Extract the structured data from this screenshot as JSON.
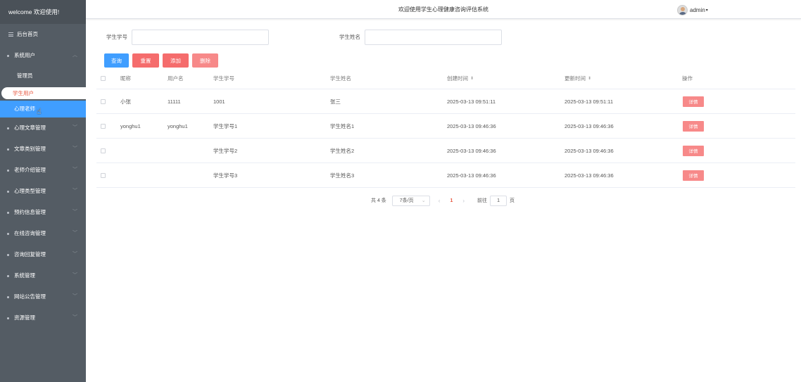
{
  "sidebar": {
    "welcome": "welcome 欢迎使用!",
    "home": "后台首页",
    "system_users": "系统用户",
    "sub_items": [
      "管理员",
      "学生用户",
      "心理老师"
    ],
    "menus": [
      "心理文章管理",
      "文章类别管理",
      "老师介绍管理",
      "心理类型管理",
      "预约信息管理",
      "在线咨询管理",
      "咨询回复管理",
      "系统管理",
      "网站公告管理",
      "资源管理"
    ]
  },
  "header": {
    "title": "欢迎使用学生心理健康咨询评估系统",
    "username": "admin"
  },
  "search": {
    "student_id_label": "学生学号",
    "student_id_value": "",
    "student_name_label": "学生姓名",
    "student_name_value": ""
  },
  "buttons": {
    "query": "查询",
    "reset": "重置",
    "add": "添加",
    "delete": "删除"
  },
  "table": {
    "columns": [
      "昵称",
      "用户名",
      "学生学号",
      "学生姓名",
      "创建时间",
      "更新时间",
      "操作"
    ],
    "rows": [
      {
        "nickname": "小张",
        "username": "11111",
        "student_id": "1001",
        "student_name": "张三",
        "created": "2025-03-13 09:51:11",
        "updated": "2025-03-13 09:51:11",
        "action": "详情"
      },
      {
        "nickname": "yonghu1",
        "username": "yonghu1",
        "student_id": "学生学号1",
        "student_name": "学生姓名1",
        "created": "2025-03-13 09:46:36",
        "updated": "2025-03-13 09:46:36",
        "action": "详情"
      },
      {
        "nickname": "",
        "username": "",
        "student_id": "学生学号2",
        "student_name": "学生姓名2",
        "created": "2025-03-13 09:46:36",
        "updated": "2025-03-13 09:46:36",
        "action": "详情"
      },
      {
        "nickname": "",
        "username": "",
        "student_id": "学生学号3",
        "student_name": "学生姓名3",
        "created": "2025-03-13 09:46:36",
        "updated": "2025-03-13 09:46:36",
        "action": "详情"
      }
    ]
  },
  "pagination": {
    "total": "共 4 条",
    "page_size": "7条/页",
    "current_page": "1",
    "goto_label": "前往",
    "goto_value": "1",
    "page_unit": "页"
  },
  "colors": {
    "sidebar_bg": "#545c64",
    "primary": "#409eff",
    "danger": "#f56c6c",
    "active_text": "#e8543c"
  }
}
